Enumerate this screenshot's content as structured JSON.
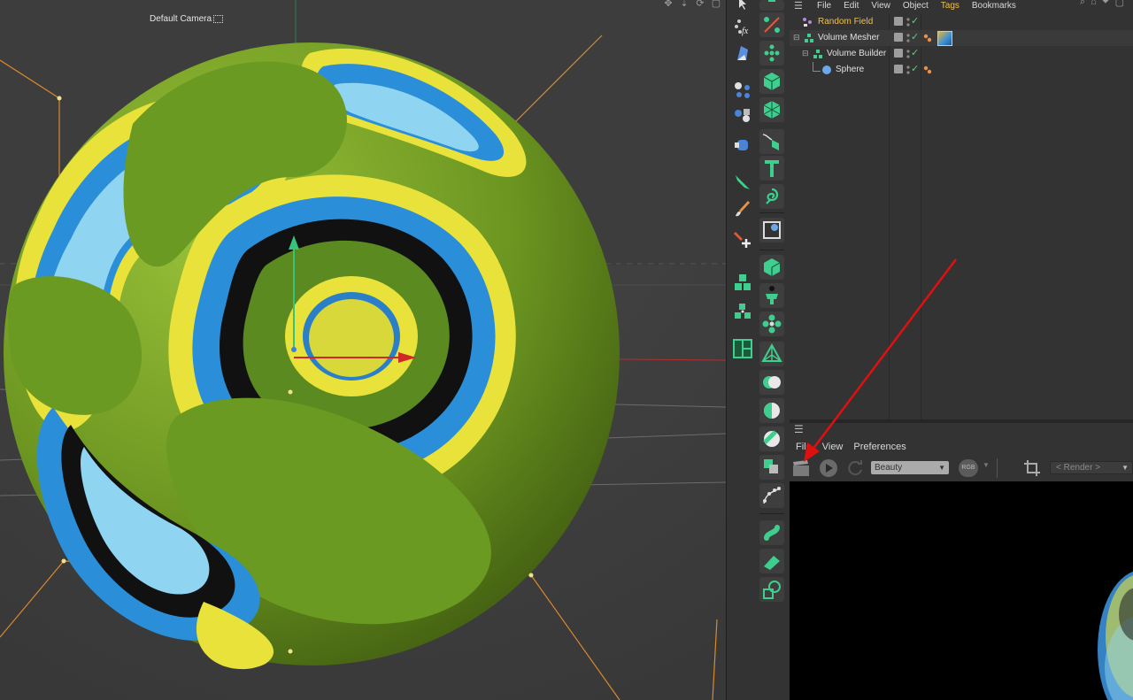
{
  "viewport": {
    "camera_label": "Default Camera"
  },
  "object_manager": {
    "menu": [
      "File",
      "Edit",
      "View",
      "Object",
      "Tags",
      "Bookmarks"
    ],
    "objects": [
      {
        "name": "Random Field"
      },
      {
        "name": "Volume Mesher"
      },
      {
        "name": "Volume Builder"
      },
      {
        "name": "Sphere"
      }
    ]
  },
  "render_panel": {
    "menu": [
      "File",
      "View",
      "Preferences"
    ],
    "pass_select": "Beauty",
    "rgb_label": "RGB",
    "render_dropdown": "< Render >"
  },
  "colors": {
    "accent": "#f0c04b",
    "active_check": "#5ad07a",
    "annotation_arrow": "#e01010",
    "tool_green": "#3ecf8e"
  }
}
